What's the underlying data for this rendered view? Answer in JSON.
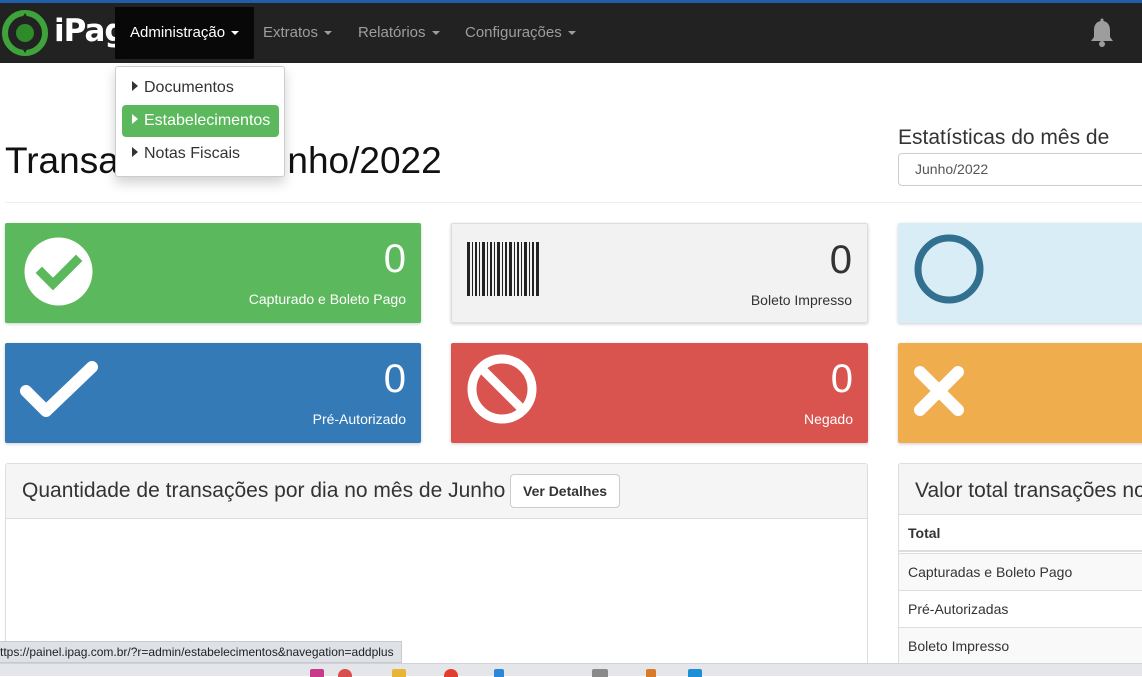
{
  "brand": {
    "name": "iPag"
  },
  "nav": {
    "items": [
      {
        "label": "Administração"
      },
      {
        "label": "Extratos"
      },
      {
        "label": "Relatórios"
      },
      {
        "label": "Configurações"
      }
    ]
  },
  "dropdown": {
    "items": [
      {
        "label": "Documentos"
      },
      {
        "label": "Estabelecimentos"
      },
      {
        "label": "Notas Fiscais"
      }
    ]
  },
  "page": {
    "title_left": "Transa",
    "title_right": "unho/2022",
    "stats_label": "Estatísticas do mês de",
    "month_value": "Junho/2022"
  },
  "cards": [
    {
      "value": "0",
      "label": "Capturado e Boleto Pago",
      "icon": "check-circle-icon",
      "color": "#5cb85c"
    },
    {
      "value": "0",
      "label": "Boleto Impresso",
      "icon": "barcode-icon",
      "color": "#f2f2f2"
    },
    {
      "value": "",
      "label": "",
      "icon": "circle-outline-icon",
      "color": "#d9edf7"
    },
    {
      "value": "0",
      "label": "Pré-Autorizado",
      "icon": "check-icon",
      "color": "#337ab7"
    },
    {
      "value": "0",
      "label": "Negado",
      "icon": "ban-icon",
      "color": "#d9534f"
    },
    {
      "value": "",
      "label": "",
      "icon": "times-icon",
      "color": "#f0ad4e"
    }
  ],
  "chart_panel": {
    "title": "Quantidade de transações por dia no mês de Junho",
    "button": "Ver Detalhes"
  },
  "total_panel": {
    "title": "Valor total transações no",
    "header": "Total",
    "rows": [
      "Capturadas e Boleto Pago",
      "Pré-Autorizadas",
      "Boleto Impresso"
    ]
  },
  "statusbar": {
    "url": "ttps://painel.ipag.com.br/?r=admin/estabelecimentos&navegation=addplus"
  }
}
